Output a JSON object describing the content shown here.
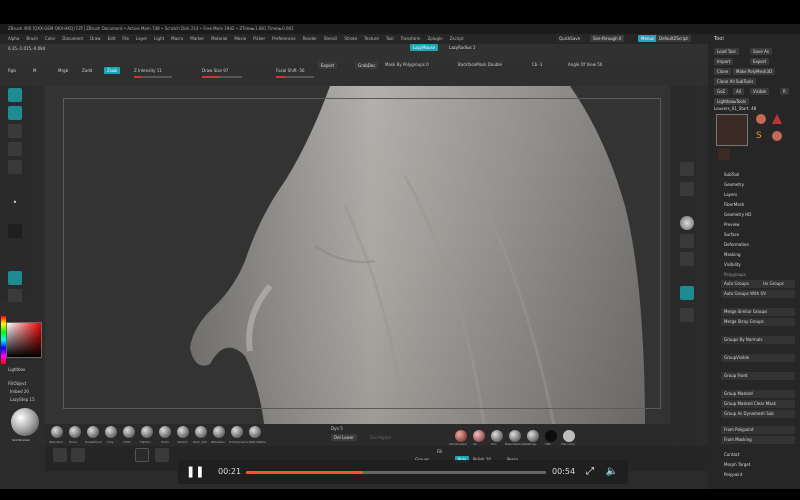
{
  "title_bar": {
    "text": "ZBrush 4R6 [QXX-GEM QKX-HKQ] FZF]   ZBrush Document   • Active Mem 748 • Scratch Disk 214 • Free Mem 1942 • ZTime►1.081 Timer►0.001"
  },
  "menu": [
    "Alpha",
    "Brush",
    "Color",
    "Document",
    "Draw",
    "Edit",
    "File",
    "Layer",
    "Light",
    "Macro",
    "Marker",
    "Material",
    "Movie",
    "Picker",
    "Preferences",
    "Render",
    "Stencil",
    "Stroke",
    "Texture",
    "Tool",
    "Transform",
    "Zplugin",
    "Zscript"
  ],
  "toolbar": {
    "quicksave": "QuickSave",
    "see_through": "See-through 0",
    "menus": "Menus",
    "default_zscript": "DefaultZScript",
    "lazymouse": "LazyMouse",
    "lazyradius": "LazyRadius 1",
    "rgb": "Rgb",
    "m": "M",
    "mrgb": "Mrgb",
    "zadd": "Zadd",
    "zsub": "Zsub",
    "z_intensity": "Z Intensity 11",
    "draw_size": "Draw Size 97",
    "focal_shift": "Focal Shift -56",
    "export": "Export",
    "grabdoc": "GrabDoc",
    "mask_by_polygroups": "Mask By Polygroups 0",
    "backface_mask": "BackfaceMask Double",
    "cb": "Cb -1",
    "angle_of_view": "Angle Of View 50",
    "coords": "0.35,-1.015,-0.084"
  },
  "left_shelf": {
    "edit": "Edit",
    "draw": "Draw",
    "move": "Move",
    "scale": "Scale",
    "rotate": "Rotate",
    "dots": "Dots",
    "alpha": "Alpha Off",
    "texture": "Texture Off"
  },
  "color_panel": {
    "lightbox": "Lightbox",
    "fillobject": "FillObject",
    "imbed": "Imbed 20",
    "lazystep": "LazyStep 15",
    "material_label": "SkinShade4"
  },
  "tray": {
    "title": "Tool",
    "load_tool": "Load Tool",
    "save_as": "Save As",
    "import": "Import",
    "export": "Export",
    "clone": "Clone",
    "make_polymesh": "Make PolyMesh3D",
    "clone_all": "Clone All SubTools",
    "goz": "GoZ",
    "all": "All",
    "visible": "Visible",
    "r": "R",
    "lightbox_tools": "Lightbox▸Tools",
    "current_tool": "Louvers_01_Start. 48",
    "sections": [
      "SubTool",
      "Geometry",
      "Layers",
      "FiberMesh",
      "Geometry HD",
      "Preview",
      "Surface",
      "Deformation",
      "Masking",
      "Visibility",
      "Polygroups"
    ],
    "polygroups_buttons": [
      "Auto Groups",
      "Uv Groups",
      "Auto Groups With UV",
      "Merge Similar Groups",
      "Merge Stray Groups",
      "Groups By Normals",
      "GroupVisible",
      "Group Front",
      "Group Masked",
      "Group Masked Clear Mask",
      "Group As Dynamesh Sub",
      "From Polypaint",
      "From Masking"
    ],
    "contact": "Contact",
    "morph_target": "Morph Target",
    "polypaint": "Polypaint"
  },
  "brushes": [
    "Standard",
    "Move",
    "SnakeHook",
    "Clay",
    "Inflat",
    "Flatten",
    "Pinch",
    "hPolish",
    "Dam_Std",
    "ZModeler",
    "TrimDynamic",
    "IMM_BParts"
  ],
  "brush_bar": {
    "dyn": "Dyn",
    "dyn_val": "Dyn 5",
    "del_lower": "Del Lower",
    "del_higher": "Del Higher"
  },
  "materials": [
    "SkinShade4",
    "Oil",
    "Pch",
    "BasicMaterial",
    "MatCap",
    "Flat",
    "Flat Color"
  ],
  "bottom": {
    "groups": "Groups",
    "fill": "Fill",
    "poly": "Poly",
    "polish": "Polish 10",
    "persp": "Persp"
  },
  "player": {
    "current_time": "00:21",
    "total_time": "00:54",
    "progress": 0.39
  }
}
